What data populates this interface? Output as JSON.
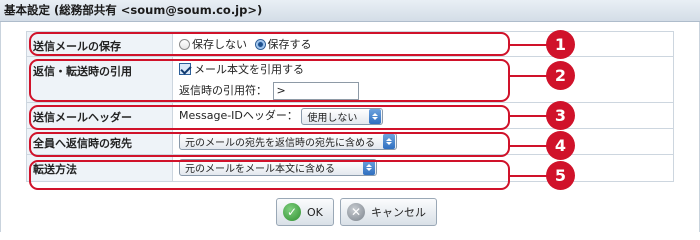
{
  "header": {
    "title": "基本設定 (総務部共有 <soum@soum.co.jp>)"
  },
  "settings": {
    "save_sent": {
      "label": "送信メールの保存",
      "options": [
        "保存しない",
        "保存する"
      ],
      "selected": "保存する"
    },
    "quote": {
      "label": "返信・転送時の引用",
      "checkbox_label": "メール本文を引用する",
      "checked": true,
      "quote_char_label": "返信時の引用符：",
      "quote_char_value": ">"
    },
    "header_setting": {
      "label": "送信メールヘッダー",
      "field_label": "Message-IDヘッダー：",
      "selected": "使用しない"
    },
    "reply_all": {
      "label": "全員へ返信時の宛先",
      "selected": "元のメールの宛先を返信時の宛先に含める"
    },
    "forward": {
      "label": "転送方法",
      "selected": "元のメールをメール本文に含める"
    }
  },
  "callouts": [
    "1",
    "2",
    "3",
    "4",
    "5"
  ],
  "buttons": {
    "ok": "OK",
    "cancel": "キャンセル"
  },
  "colors": {
    "highlight": "#d0122a",
    "label_bg": "#eef3f8"
  }
}
